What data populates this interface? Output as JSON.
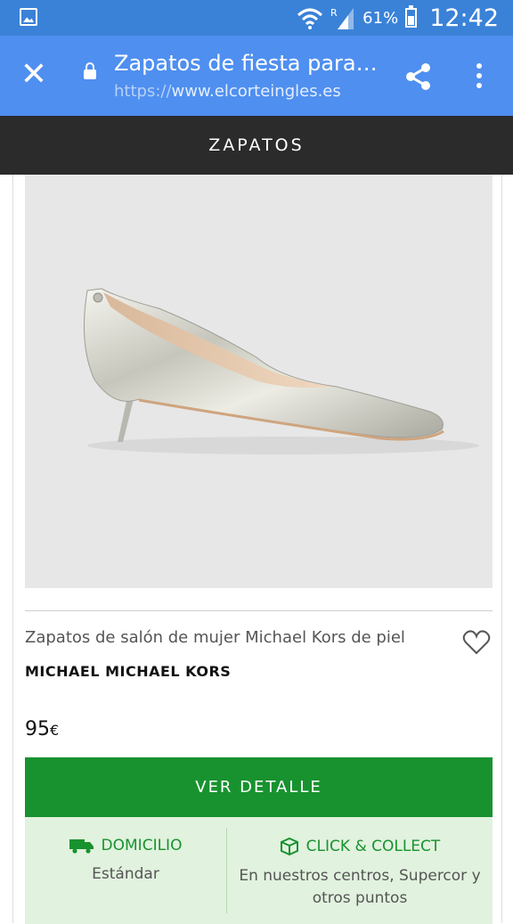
{
  "status_bar": {
    "battery": "61%",
    "time": "12:42"
  },
  "top_bar": {
    "title": "Zapatos de fiesta para…",
    "url_protocol": "https://",
    "url_host": "www.elcorteingles.es"
  },
  "section": {
    "title": "ZAPATOS"
  },
  "product": {
    "name": "Zapatos de salón de mujer Michael Kors de piel",
    "brand": "MICHAEL MICHAEL KORS",
    "price": "95",
    "currency": "€",
    "cta_label": "VER DETALLE"
  },
  "delivery": {
    "home_label": "DOMICILIO",
    "home_sub": "Estándar",
    "collect_label": "CLICK & COLLECT",
    "collect_sub": "En nuestros centros, Supercor y otros puntos"
  },
  "colors": {
    "status_bar": "#3a82d8",
    "top_bar": "#4f8ff0",
    "section_bar": "#2b2b2b",
    "cta_green": "#18922f",
    "delivery_bg": "#e1f2de"
  },
  "icons": [
    "gallery-icon",
    "wifi-icon",
    "signal-icon",
    "battery-icon",
    "close-icon",
    "lock-icon",
    "share-icon",
    "more-vert-icon",
    "heart-icon",
    "truck-icon",
    "box-icon"
  ]
}
